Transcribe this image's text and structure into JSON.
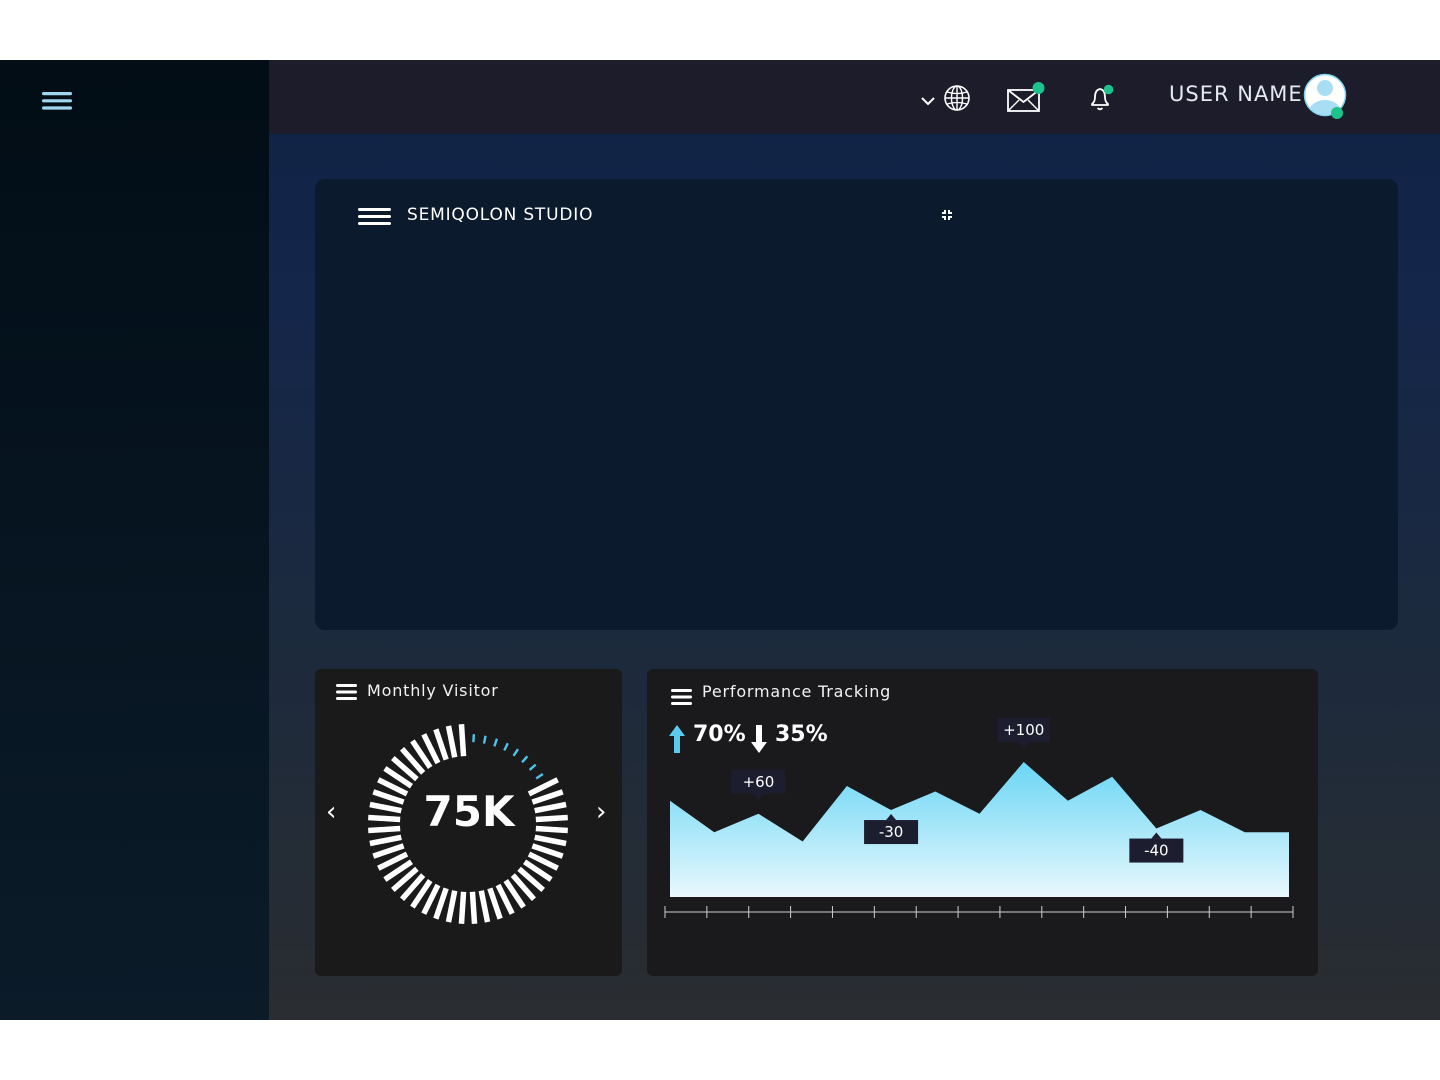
{
  "header": {
    "username": "USER NAME",
    "icons": [
      "chevron-down-icon",
      "globe-icon",
      "mail-icon",
      "bell-icon",
      "user-avatar-icon"
    ],
    "status_color": "#1ec38c"
  },
  "main_card": {
    "title": "SEMIQOLON STUDIO"
  },
  "visitor_card": {
    "title": "Monthly Visitor",
    "value": "75K",
    "prev_label": "‹",
    "next_label": "›",
    "progress_fraction": 0.17,
    "accent": "#4fc3ea"
  },
  "performance_card": {
    "title": "Performance Tracking",
    "up_percent": "70%",
    "down_percent": "35%",
    "chart_data": {
      "type": "area",
      "x": [
        0,
        1,
        2,
        3,
        4,
        5,
        6,
        7,
        8,
        9,
        10,
        11,
        12,
        13,
        14
      ],
      "values": [
        52,
        35,
        45,
        30,
        60,
        47,
        57,
        45,
        73,
        52,
        65,
        37,
        47,
        35,
        35
      ],
      "annotations": [
        {
          "label": "+60",
          "index": 2,
          "position": "above"
        },
        {
          "label": "-30",
          "index": 5,
          "position": "below"
        },
        {
          "label": "+100",
          "index": 8,
          "position": "above"
        },
        {
          "label": "-40",
          "index": 11,
          "position": "below"
        }
      ],
      "color_top": "#6ad6f5",
      "color_bottom": "#e8f8fd"
    }
  }
}
